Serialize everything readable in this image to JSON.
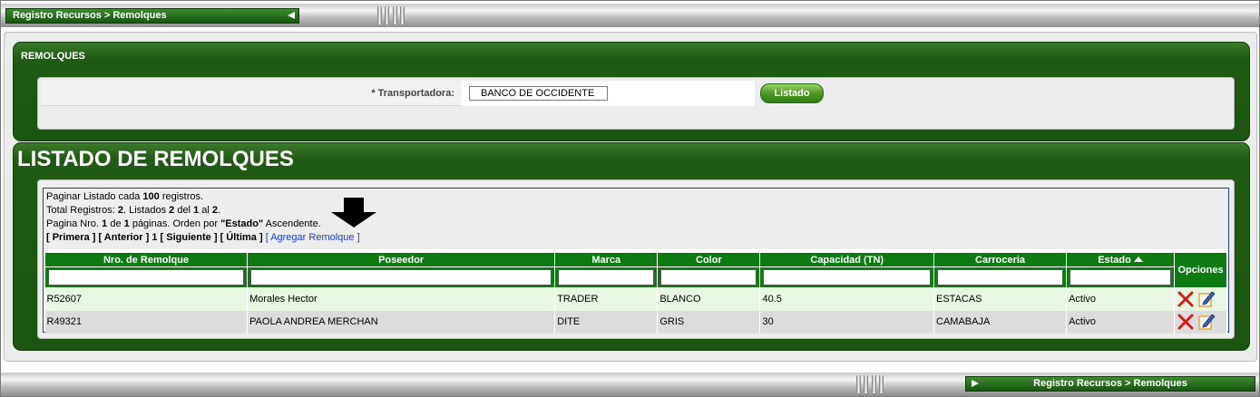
{
  "breadcrumb": {
    "text": "Registro Recursos > Remolques"
  },
  "section_filter": {
    "title": "REMOLQUES",
    "transportadora_label": "* Transportadora:",
    "transportadora_value": "BANCO DE OCCIDENTE",
    "listado_button": "Listado"
  },
  "section_list": {
    "title": "LISTADO DE REMOLQUES",
    "info": {
      "line1_pre": "Paginar Listado cada ",
      "per_page": "100",
      "line1_post": " registros.",
      "line2_a": "Total Registros: ",
      "total": "2",
      "line2_b": ". Listados ",
      "listed": "2",
      "line2_c": " del ",
      "from": "1",
      "line2_d": " al ",
      "to": "2",
      "line2_e": ".",
      "line3_a": "Pagina Nro. ",
      "page": "1",
      "line3_b": " de ",
      "pages": "1",
      "line3_c": " páginas. Orden por ",
      "order_field": "\"Estado\"",
      "line3_d": " Ascendente."
    },
    "pager": {
      "first": "[ Primera ]",
      "prev": "[ Anterior ]",
      "current": "1",
      "next": "[ Siguiente ]",
      "last": "[ Última ]",
      "add": "[ Agregar Remolque ]"
    },
    "columns": [
      "Nro. de Remolque",
      "Poseedor",
      "Marca",
      "Color",
      "Capacidad (TN)",
      "Carroceria",
      "Estado",
      "Opciones"
    ],
    "rows": [
      [
        "R52607",
        "Morales Hector",
        "TRADER",
        "BLANCO",
        "40.5",
        "ESTACAS",
        "Activo"
      ],
      [
        "R49321",
        "PAOLA ANDREA MERCHAN",
        "DITE",
        "GRIS",
        "30",
        "CAMABAJA",
        "Activo"
      ]
    ]
  },
  "colors": {
    "green_dark": "#1b5510",
    "header_green": "#0e7a12",
    "button_green": "#4d9a21",
    "link_blue": "#1f3ec8",
    "delete_red": "#d61a1a"
  }
}
